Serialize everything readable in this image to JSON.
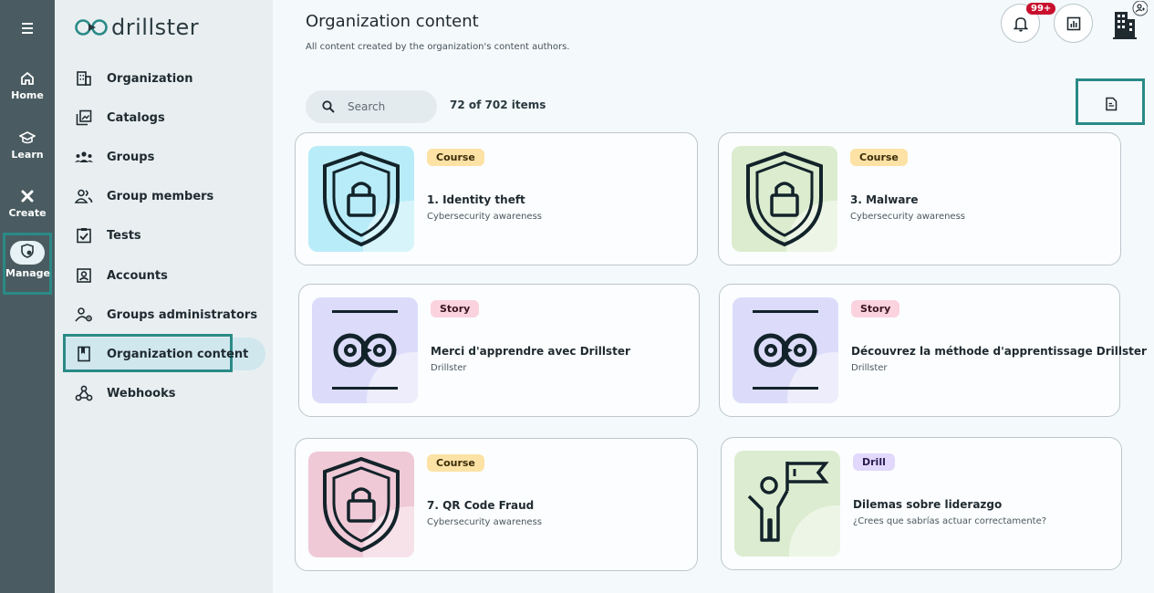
{
  "rail": {
    "items": [
      {
        "label": "Home"
      },
      {
        "label": "Learn"
      },
      {
        "label": "Create"
      },
      {
        "label": "Manage"
      }
    ]
  },
  "brand": {
    "name": "drillster"
  },
  "sidebar": {
    "items": [
      {
        "label": "Organization"
      },
      {
        "label": "Catalogs"
      },
      {
        "label": "Groups"
      },
      {
        "label": "Group members"
      },
      {
        "label": "Tests"
      },
      {
        "label": "Accounts"
      },
      {
        "label": "Groups administrators"
      },
      {
        "label": "Organization content"
      },
      {
        "label": "Webhooks"
      }
    ]
  },
  "header": {
    "title": "Organization content",
    "subtitle": "All content created by the organization's content authors.",
    "notification_badge": "99+"
  },
  "toolbar": {
    "search_placeholder": "Search",
    "count": "72 of 702 items"
  },
  "colors": {
    "accent": "#2a8a86",
    "rail": "#4a5c61",
    "badge": "#c8102e"
  },
  "cards": [
    {
      "tag": "Course",
      "title": "1. Identity theft",
      "subtitle": "Cybersecurity awareness",
      "icon": "shield-lock-icon",
      "bg": "#b8ecf8"
    },
    {
      "tag": "Course",
      "title": "3. Malware",
      "subtitle": "Cybersecurity awareness",
      "icon": "shield-lock-icon",
      "bg": "#dbeccf"
    },
    {
      "tag": "Story",
      "title": "Merci d'apprendre avec Drillster",
      "subtitle": "Drillster",
      "icon": "drillster-logo-icon",
      "bg": "#dcdcfa"
    },
    {
      "tag": "Story",
      "title": "Découvrez la méthode d'apprentissage Drillster",
      "subtitle": "Drillster",
      "icon": "drillster-logo-icon",
      "bg": "#dcdcfa"
    },
    {
      "tag": "Course",
      "title": "7. QR Code Fraud",
      "subtitle": "Cybersecurity awareness",
      "icon": "shield-lock-icon",
      "bg": "#efc9d6"
    },
    {
      "tag": "Drill",
      "title": "Dilemas sobre liderazgo",
      "subtitle": "¿Crees que sabrías actuar correctamente?",
      "icon": "person-flag-icon",
      "bg": "#dcecd0"
    }
  ]
}
